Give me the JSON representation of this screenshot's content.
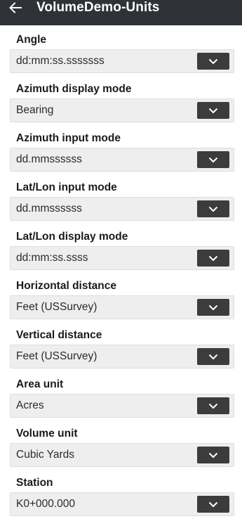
{
  "appbar": {
    "title": "VolumeDemo-Units",
    "back_icon": "arrow-left-icon"
  },
  "colors": {
    "appbar_bg": "#2f3236",
    "select_bg": "#eeeeee",
    "dropdown_button_bg": "#3c3c3c"
  },
  "fields": [
    {
      "label": "Angle",
      "value": "dd:mm:ss.sssssss"
    },
    {
      "label": "Azimuth display mode",
      "value": "Bearing"
    },
    {
      "label": "Azimuth input mode",
      "value": "dd.mmssssss"
    },
    {
      "label": "Lat/Lon input mode",
      "value": "dd.mmssssss"
    },
    {
      "label": "Lat/Lon display mode",
      "value": "dd:mm:ss.ssss"
    },
    {
      "label": "Horizontal distance",
      "value": "Feet (USSurvey)"
    },
    {
      "label": "Vertical distance",
      "value": "Feet (USSurvey)"
    },
    {
      "label": "Area unit",
      "value": "Acres"
    },
    {
      "label": "Volume unit",
      "value": "Cubic Yards"
    },
    {
      "label": "Station",
      "value": "K0+000.000"
    }
  ]
}
